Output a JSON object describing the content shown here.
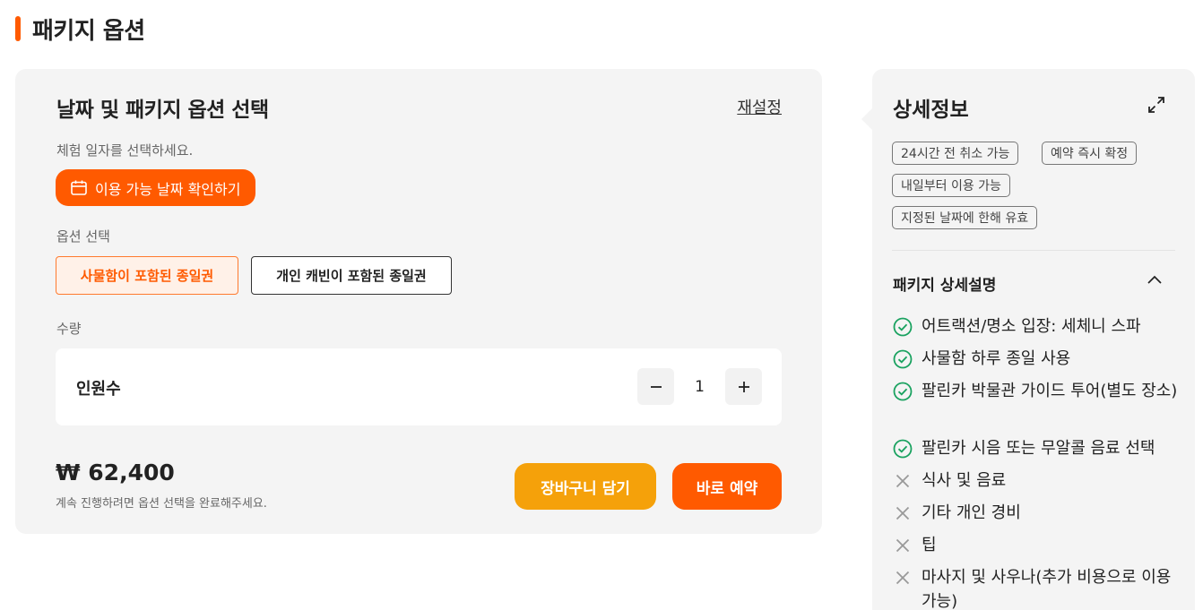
{
  "section": {
    "title": "패키지 옵션"
  },
  "options_panel": {
    "title": "날짜 및 패키지 옵션 선택",
    "reset_label": "재설정",
    "date_prompt": "체험 일자를 선택하세요.",
    "date_button_label": "이용 가능 날짜 확인하기",
    "option_label": "옵션 선택",
    "options": [
      {
        "label": "사물함이 포함된 종일권",
        "selected": true
      },
      {
        "label": "개인 캐빈이 포함된 종일권",
        "selected": false
      }
    ],
    "quantity_label": "수량",
    "quantity_row_label": "인원수",
    "quantity_value": "1",
    "price": "₩ 62,400",
    "price_note": "계속 진행하려면 옵션 선택을 완료해주세요.",
    "cart_button_label": "장바구니 담기",
    "book_button_label": "바로 예약"
  },
  "detail_panel": {
    "title": "상세정보",
    "tags": [
      "24시간 전 취소 가능",
      "예약 즉시 확정",
      "내일부터 이용 가능",
      "지정된 날짜에 한해 유효"
    ],
    "package_title": "패키지 상세설명",
    "features": [
      {
        "text": "어트랙션/명소 입장: 세체니 스파",
        "included": true
      },
      {
        "text": "사물함 하루 종일 사용",
        "included": true
      },
      {
        "text": "팔린카 박물관 가이드 투어(별도 장소)",
        "included": true
      },
      {
        "text": "팔린카 시음 또는 무알콜 음료 선택",
        "included": true
      },
      {
        "text": "식사 및 음료",
        "included": false
      },
      {
        "text": "기타 개인 경비",
        "included": false
      },
      {
        "text": "팁",
        "included": false
      },
      {
        "text": "마사지 및 사우나(추가 비용으로 이용 가능)",
        "included": false
      }
    ]
  },
  "colors": {
    "accent": "#ff5a00",
    "cart": "#f5a10a",
    "included_check": "#1aa260",
    "excluded_x": "#999999",
    "panel_bg": "#f4f4f4"
  }
}
